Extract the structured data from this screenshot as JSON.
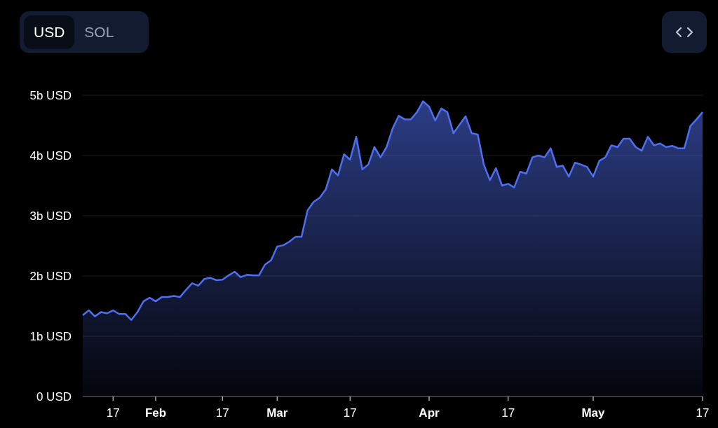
{
  "currency_toggle": [
    {
      "label": "USD",
      "selected": true
    },
    {
      "label": "SOL",
      "selected": false
    }
  ],
  "chart": {
    "chart_data": {
      "type": "area",
      "grid": true,
      "ylim": [
        0,
        5
      ],
      "yticks": [
        {
          "value": 0,
          "label": "0 USD"
        },
        {
          "value": 1,
          "label": "1b USD"
        },
        {
          "value": 2,
          "label": "2b USD"
        },
        {
          "value": 3,
          "label": "3b USD"
        },
        {
          "value": 4,
          "label": "4b USD"
        },
        {
          "value": 5,
          "label": "5b USD"
        }
      ],
      "categories": [
        null,
        null,
        null,
        null,
        null,
        "17",
        null,
        null,
        null,
        null,
        null,
        null,
        "Feb",
        null,
        null,
        null,
        null,
        null,
        null,
        null,
        null,
        null,
        null,
        "17",
        null,
        null,
        null,
        null,
        null,
        null,
        null,
        null,
        "Mar",
        null,
        null,
        null,
        null,
        null,
        null,
        null,
        null,
        null,
        null,
        null,
        "17",
        null,
        null,
        null,
        null,
        null,
        null,
        null,
        null,
        null,
        null,
        null,
        null,
        "Apr",
        null,
        null,
        null,
        null,
        null,
        null,
        null,
        null,
        null,
        null,
        null,
        null,
        "17",
        null,
        null,
        null,
        null,
        null,
        null,
        null,
        null,
        null,
        null,
        null,
        null,
        null,
        "May",
        null,
        null,
        null,
        null,
        null,
        null,
        null,
        null,
        null,
        null,
        null,
        null,
        null,
        null,
        null,
        null,
        null,
        "17"
      ],
      "series": [
        {
          "color": "#4f6ef0",
          "values": [
            1.35,
            1.43,
            1.33,
            1.4,
            1.38,
            1.43,
            1.37,
            1.37,
            1.27,
            1.4,
            1.58,
            1.64,
            1.58,
            1.65,
            1.65,
            1.67,
            1.65,
            1.77,
            1.88,
            1.84,
            1.95,
            1.97,
            1.93,
            1.94,
            2.01,
            2.07,
            1.98,
            2.02,
            2.01,
            2.01,
            2.19,
            2.26,
            2.49,
            2.51,
            2.57,
            2.65,
            2.65,
            3.09,
            3.23,
            3.3,
            3.44,
            3.77,
            3.67,
            4.02,
            3.93,
            4.31,
            3.77,
            3.85,
            4.14,
            3.97,
            4.14,
            4.45,
            4.66,
            4.6,
            4.6,
            4.72,
            4.9,
            4.81,
            4.58,
            4.78,
            4.72,
            4.37,
            4.51,
            4.65,
            4.37,
            4.35,
            3.85,
            3.59,
            3.79,
            3.5,
            3.53,
            3.47,
            3.73,
            3.7,
            3.97,
            4.0,
            3.97,
            4.12,
            3.81,
            3.83,
            3.65,
            3.88,
            3.85,
            3.81,
            3.65,
            3.91,
            3.97,
            4.17,
            4.14,
            4.28,
            4.28,
            4.14,
            4.08,
            4.31,
            4.17,
            4.2,
            4.14,
            4.16,
            4.12,
            4.12,
            4.49,
            4.6,
            4.72
          ]
        }
      ]
    }
  }
}
